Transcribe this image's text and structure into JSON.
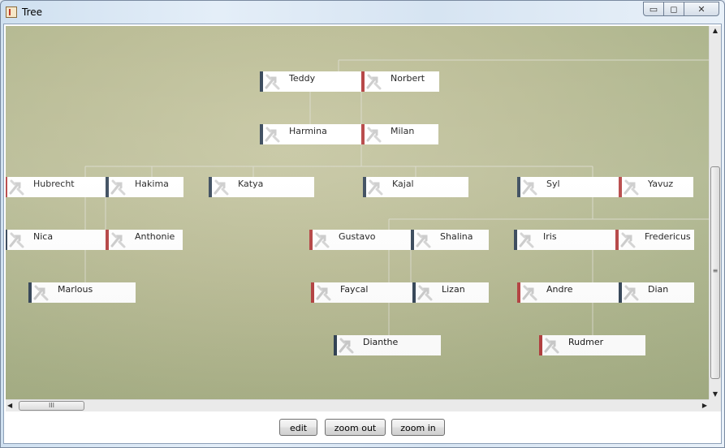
{
  "window": {
    "title": "Tree",
    "minimize_glyph": "▭",
    "maximize_glyph": "◻",
    "close_glyph": "✕"
  },
  "colors": {
    "male": "#2e3f52",
    "female": "#b23a3a",
    "canvas_bg": "#b8ba92",
    "connector": "#d6d6c6"
  },
  "tree": {
    "nodes": [
      {
        "id": "teddy",
        "name": "Teddy",
        "sex": "male",
        "row": 0
      },
      {
        "id": "norbert",
        "name": "Norbert",
        "sex": "female",
        "row": 0
      },
      {
        "id": "harmina",
        "name": "Harmina",
        "sex": "male",
        "row": 1
      },
      {
        "id": "milan",
        "name": "Milan",
        "sex": "female",
        "row": 1
      },
      {
        "id": "hubrecht",
        "name": "Hubrecht",
        "sex": "female",
        "row": 2
      },
      {
        "id": "hakima",
        "name": "Hakima",
        "sex": "male",
        "row": 2
      },
      {
        "id": "katya",
        "name": "Katya",
        "sex": "male",
        "row": 2
      },
      {
        "id": "kajal",
        "name": "Kajal",
        "sex": "male",
        "row": 2
      },
      {
        "id": "syl",
        "name": "Syl",
        "sex": "male",
        "row": 2
      },
      {
        "id": "yavuz",
        "name": "Yavuz",
        "sex": "female",
        "row": 2
      },
      {
        "id": "nica",
        "name": "Nica",
        "sex": "male",
        "row": 3
      },
      {
        "id": "anthonie",
        "name": "Anthonie",
        "sex": "female",
        "row": 3
      },
      {
        "id": "gustavo",
        "name": "Gustavo",
        "sex": "female",
        "row": 3
      },
      {
        "id": "shalina",
        "name": "Shalina",
        "sex": "male",
        "row": 3
      },
      {
        "id": "iris",
        "name": "Iris",
        "sex": "male",
        "row": 3
      },
      {
        "id": "fredericus",
        "name": "Fredericus",
        "sex": "female",
        "row": 3
      },
      {
        "id": "marlous",
        "name": "Marlous",
        "sex": "male",
        "row": 4
      },
      {
        "id": "faycal",
        "name": "Faycal",
        "sex": "female",
        "row": 4
      },
      {
        "id": "lizan",
        "name": "Lizan",
        "sex": "male",
        "row": 4
      },
      {
        "id": "andre",
        "name": "Andre",
        "sex": "female",
        "row": 4
      },
      {
        "id": "dian",
        "name": "Dian",
        "sex": "male",
        "row": 4
      },
      {
        "id": "dianthe",
        "name": "Dianthe",
        "sex": "male",
        "row": 5
      },
      {
        "id": "rudmer",
        "name": "Rudmer",
        "sex": "female",
        "row": 5
      }
    ]
  },
  "scrollbars": {
    "vertical_grip": "≡",
    "horizontal_grip": "III",
    "up_arrow": "▲",
    "down_arrow": "▼",
    "left_arrow": "◀",
    "right_arrow": "▶"
  },
  "toolbar": {
    "edit_label": "edit",
    "zoom_out_label": "zoom out",
    "zoom_in_label": "zoom in"
  }
}
